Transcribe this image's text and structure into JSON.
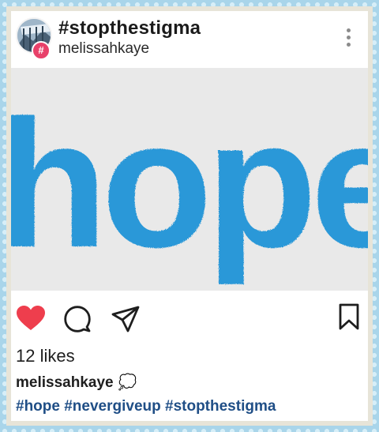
{
  "post": {
    "title": "#stopthestigma",
    "username": "melissahkaye",
    "badge_symbol": "#",
    "image_text": "hope.",
    "likes_text": "12 likes",
    "caption_user": "melissahkaye",
    "caption_emoji": "💭",
    "hashtags": "#hope #nevergiveup #stopthestigma",
    "liked": true
  },
  "icons": {
    "like": "heart-icon",
    "comment": "comment-icon",
    "share": "share-icon",
    "save": "bookmark-icon",
    "more": "more-vertical-icon"
  },
  "colors": {
    "heart": "#ee3e4d",
    "hope_text": "#2a98d8",
    "hashtags": "#1f4e86",
    "badge": "#e8416a",
    "frame": "#a9d5ea"
  }
}
